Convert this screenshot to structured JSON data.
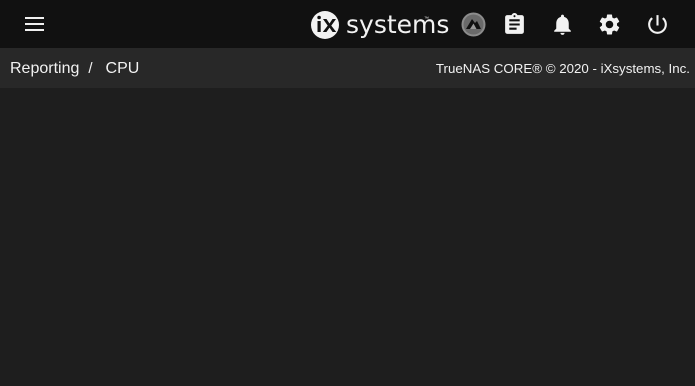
{
  "topbar": {
    "menu_icon": "hamburger-menu-icon",
    "logo": {
      "text": "systems",
      "mark": "iX",
      "trademark": "™"
    },
    "icons": [
      "truecommand-icon",
      "clipboard-tasks-icon",
      "bell-notifications-icon",
      "gear-settings-icon",
      "power-icon"
    ]
  },
  "breadcrumb": {
    "parent": "Reporting",
    "separator": "/",
    "current": "CPU"
  },
  "copyright": "TrueNAS CORE® © 2020 - iXsystems, Inc.",
  "colors": {
    "topbar": "#111111",
    "subbar": "#282828",
    "background": "#1e1e1e",
    "text": "#f2f2f2"
  }
}
